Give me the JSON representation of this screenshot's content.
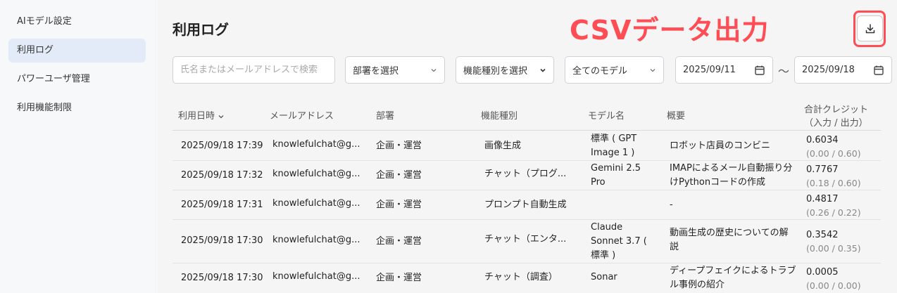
{
  "sidebar": {
    "items": [
      {
        "label": "AIモデル設定",
        "active": false
      },
      {
        "label": "利用ログ",
        "active": true
      },
      {
        "label": "パワーユーザ管理",
        "active": false
      },
      {
        "label": "利用機能制限",
        "active": false
      }
    ]
  },
  "header": {
    "title": "利用ログ",
    "csv_callout": "CSVデータ出力"
  },
  "filters": {
    "search_placeholder": "氏名またはメールアドレスで検索",
    "department": "部署を選択",
    "feature": "機能種別を選択",
    "model": "全てのモデル",
    "date_from": "2025/09/11",
    "date_to": "2025/09/18",
    "separator": "〜"
  },
  "table": {
    "headers": {
      "datetime": "利用日時",
      "email": "メールアドレス",
      "department": "部署",
      "feature": "機能種別",
      "model": "モデル名",
      "summary": "概要",
      "credit": "合計クレジット",
      "credit_sub": "（入力 / 出力）"
    },
    "rows": [
      {
        "datetime": "2025/09/18 17:39",
        "email": "knowlefulchat@g...",
        "department": "企画・運営",
        "feature": "画像生成",
        "model": "標準 ( GPT Image 1 )",
        "summary": "ロボット店員のコンビニ",
        "credit": "0.6034",
        "credit_detail": "(0.00 / 0.60)"
      },
      {
        "datetime": "2025/09/18 17:32",
        "email": "knowlefulchat@g...",
        "department": "企画・運営",
        "feature": "チャット（プログ...",
        "model": "Gemini 2.5 Pro",
        "summary": "IMAPによるメール自動振り分けPythonコードの作成",
        "credit": "0.7767",
        "credit_detail": "(0.18 / 0.60)"
      },
      {
        "datetime": "2025/09/18 17:31",
        "email": "knowlefulchat@g...",
        "department": "企画・運営",
        "feature": "プロンプト自動生成",
        "model": "",
        "summary": "-",
        "credit": "0.4817",
        "credit_detail": "(0.26 / 0.22)"
      },
      {
        "datetime": "2025/09/18 17:30",
        "email": "knowlefulchat@g...",
        "department": "企画・運営",
        "feature": "チャット（エンタ...",
        "model": "Claude Sonnet 3.7 ( 標準 )",
        "summary": "動画生成の歴史についての解説",
        "credit": "0.3542",
        "credit_detail": "(0.00 / 0.35)"
      },
      {
        "datetime": "2025/09/18 17:30",
        "email": "knowlefulchat@g...",
        "department": "企画・運営",
        "feature": "チャット（調査）",
        "model": "Sonar",
        "summary": "ディープフェイクによるトラブル事例の紹介",
        "credit": "0.0005",
        "credit_detail": "(0.00 / 0.00)"
      }
    ]
  },
  "colors": {
    "callout": "#ff4d55",
    "active_nav": "#e4ebf8"
  }
}
